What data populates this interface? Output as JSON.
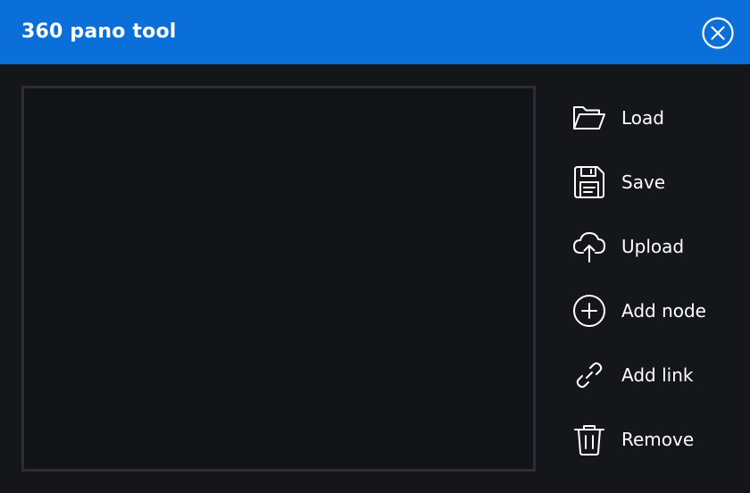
{
  "window": {
    "title": "360 pano tool"
  },
  "actions": [
    {
      "id": "load",
      "label": "Load",
      "icon": "folder-open-icon"
    },
    {
      "id": "save",
      "label": "Save",
      "icon": "floppy-disk-icon"
    },
    {
      "id": "upload",
      "label": "Upload",
      "icon": "cloud-upload-icon"
    },
    {
      "id": "add-node",
      "label": "Add node",
      "icon": "plus-circle-icon"
    },
    {
      "id": "add-link",
      "label": "Add link",
      "icon": "link-icon"
    },
    {
      "id": "remove",
      "label": "Remove",
      "icon": "trash-icon"
    }
  ],
  "colors": {
    "titlebar": "#0a6fd8",
    "background": "#14161a",
    "canvas_border": "#2b2e34",
    "text": "#ffffff"
  }
}
